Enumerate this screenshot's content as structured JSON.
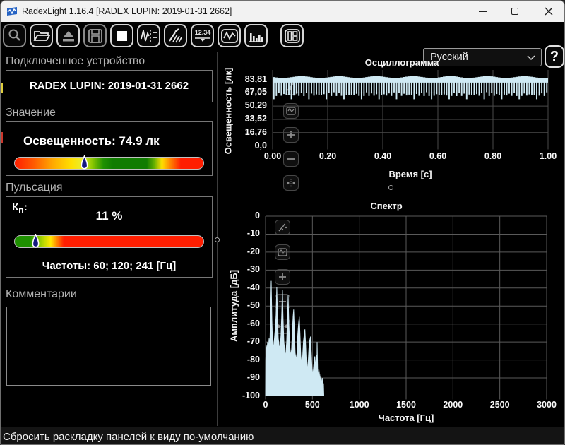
{
  "window": {
    "title": "RadexLight 1.16.4 [RADEX LUPIN: 2019-01-31 2662]"
  },
  "toolbar": {
    "value_display_icon_text": "12.34",
    "language": {
      "selected": "Русский"
    },
    "help_label": "?"
  },
  "sidebar": {
    "device": {
      "header": "Подключенное устройство",
      "name": "RADEX LUPIN: 2019-01-31 2662"
    },
    "value": {
      "header": "Значение",
      "reading": "Освещенность: 74.9 лк",
      "gauge": {
        "marker_pos": 0.37,
        "stops": [
          [
            "0%",
            "#ff1e00"
          ],
          [
            "10%",
            "#ff5a00"
          ],
          [
            "20%",
            "#ffa800"
          ],
          [
            "30%",
            "#ffe000"
          ],
          [
            "36%",
            "#e8ee30"
          ],
          [
            "41%",
            "#8cc800"
          ],
          [
            "47%",
            "#1e9000"
          ],
          [
            "52%",
            "#107c00"
          ],
          [
            "70%",
            "#107c00"
          ],
          [
            "74%",
            "#66b000"
          ],
          [
            "78%",
            "#ffe000"
          ],
          [
            "83%",
            "#ff7a00"
          ],
          [
            "88%",
            "#ff1e00"
          ],
          [
            "100%",
            "#ff1e00"
          ]
        ]
      }
    },
    "pulsation": {
      "header": "Пульсация",
      "kp_label": "К",
      "kp_sub": "п",
      "kp_colon": ":",
      "value": "11 %",
      "gauge": {
        "marker_pos": 0.11,
        "stops": [
          [
            "0%",
            "#1e9000"
          ],
          [
            "8%",
            "#1e9000"
          ],
          [
            "12%",
            "#7ac400"
          ],
          [
            "16%",
            "#c8dc00"
          ],
          [
            "19%",
            "#ffe800"
          ],
          [
            "22%",
            "#ff9000"
          ],
          [
            "26%",
            "#ff1e00"
          ],
          [
            "100%",
            "#ff1e00"
          ]
        ]
      },
      "frequencies": "Частоты: 60; 120; 241 [Гц]"
    },
    "comments": {
      "header": "Комментарии",
      "text": ""
    }
  },
  "status_bar": {
    "text": "Сбросить раскладку панелей к виду по-умолчанию"
  },
  "colors": {
    "waveform": "#cfe9f3",
    "grid_osc": "#4a4a4a",
    "grid_spec": "#5a5a5a",
    "axis": "#a0a0a0",
    "marker_fill": "#141a80",
    "marker_stroke": "#ffffff"
  },
  "chart_data": [
    {
      "type": "line",
      "title": "Осциллограмма",
      "xlabel": "Время [с]",
      "ylabel": "Освещенность [лк]",
      "xticks": [
        "0.00",
        "0.20",
        "0.40",
        "0.60",
        "0.80",
        "1.00"
      ],
      "xtick_values": [
        0,
        0.2,
        0.4,
        0.6,
        0.8,
        1.0
      ],
      "yticks": [
        "83,81",
        "67,05",
        "50,29",
        "33,52",
        "16,76",
        "0,0"
      ],
      "ytick_values": [
        83.81,
        67.05,
        50.29,
        33.52,
        16.76,
        0
      ],
      "xlim": [
        0,
        1
      ],
      "ylim": [
        0,
        96
      ],
      "grid": true,
      "waveform": {
        "shape": "rectified-flicker",
        "cycles": 110,
        "band_top_lx": 87,
        "band_bottom_lx": 72,
        "spike_min_lx": 59,
        "spike_max_lx": 68,
        "mean_lx": 74.9
      }
    },
    {
      "type": "area",
      "title": "Спектр",
      "xlabel": "Частота [Гц]",
      "ylabel": "Амплитуда [дБ]",
      "xticks": [
        "0",
        "500",
        "1000",
        "1500",
        "2000",
        "2500",
        "3000"
      ],
      "xtick_values": [
        0,
        500,
        1000,
        1500,
        2000,
        2500,
        3000
      ],
      "yticks": [
        "0",
        "-10",
        "-20",
        "-30",
        "-40",
        "-50",
        "-60",
        "-70",
        "-80",
        "-90",
        "-100"
      ],
      "ytick_values": [
        0,
        -10,
        -20,
        -30,
        -40,
        -50,
        -60,
        -70,
        -80,
        -90,
        -100
      ],
      "xlim": [
        0,
        3000
      ],
      "ylim": [
        -100,
        0
      ],
      "grid": true,
      "peak_frequencies_hz": [
        60,
        120,
        241
      ],
      "points": [
        [
          0,
          -100
        ],
        [
          2,
          -80
        ],
        [
          8,
          -72
        ],
        [
          15,
          -75
        ],
        [
          22,
          -70
        ],
        [
          30,
          -74
        ],
        [
          38,
          -68
        ],
        [
          45,
          -72
        ],
        [
          52,
          -58
        ],
        [
          60,
          -36
        ],
        [
          68,
          -58
        ],
        [
          75,
          -70
        ],
        [
          85,
          -73
        ],
        [
          95,
          -68
        ],
        [
          105,
          -62
        ],
        [
          112,
          -55
        ],
        [
          120,
          -39.5
        ],
        [
          128,
          -56
        ],
        [
          136,
          -68
        ],
        [
          145,
          -72
        ],
        [
          155,
          -74
        ],
        [
          165,
          -66
        ],
        [
          172,
          -56
        ],
        [
          180,
          -41
        ],
        [
          188,
          -58
        ],
        [
          196,
          -70
        ],
        [
          205,
          -75
        ],
        [
          215,
          -78
        ],
        [
          225,
          -70
        ],
        [
          233,
          -58
        ],
        [
          241,
          -44
        ],
        [
          249,
          -60
        ],
        [
          258,
          -72
        ],
        [
          268,
          -78
        ],
        [
          278,
          -74
        ],
        [
          288,
          -62
        ],
        [
          294,
          -56
        ],
        [
          300,
          -52
        ],
        [
          308,
          -64
        ],
        [
          316,
          -76
        ],
        [
          326,
          -80
        ],
        [
          336,
          -76
        ],
        [
          344,
          -66
        ],
        [
          352,
          -60
        ],
        [
          360,
          -56
        ],
        [
          368,
          -66
        ],
        [
          376,
          -78
        ],
        [
          386,
          -82
        ],
        [
          396,
          -78
        ],
        [
          404,
          -70
        ],
        [
          412,
          -66
        ],
        [
          420,
          -63
        ],
        [
          428,
          -72
        ],
        [
          436,
          -82
        ],
        [
          446,
          -85
        ],
        [
          456,
          -80
        ],
        [
          464,
          -72
        ],
        [
          472,
          -69
        ],
        [
          480,
          -67
        ],
        [
          488,
          -76
        ],
        [
          496,
          -85
        ],
        [
          506,
          -88
        ],
        [
          516,
          -82
        ],
        [
          526,
          -78
        ],
        [
          534,
          -85
        ],
        [
          541,
          -77
        ],
        [
          548,
          -84
        ],
        [
          550,
          -70
        ],
        [
          556,
          -86
        ],
        [
          562,
          -90
        ],
        [
          568,
          -85
        ],
        [
          575,
          -88
        ],
        [
          582,
          -92
        ],
        [
          590,
          -88
        ],
        [
          598,
          -94
        ],
        [
          605,
          -90
        ],
        [
          612,
          -97
        ],
        [
          618,
          -93
        ],
        [
          622,
          -100
        ]
      ]
    }
  ]
}
